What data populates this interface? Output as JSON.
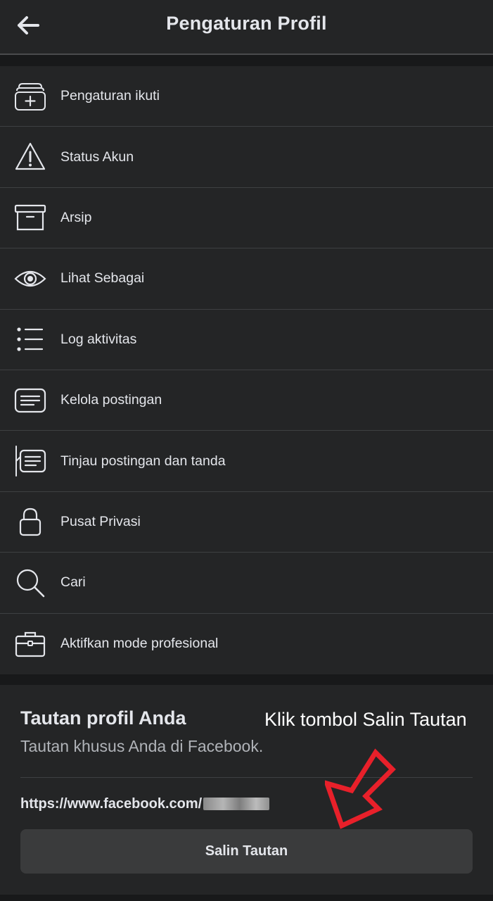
{
  "header": {
    "title": "Pengaturan Profil",
    "back_icon": "arrow-left-icon"
  },
  "menu": {
    "items": [
      {
        "label": "Pengaturan ikuti",
        "icon": "follow-settings-icon"
      },
      {
        "label": "Status Akun",
        "icon": "warning-icon"
      },
      {
        "label": "Arsip",
        "icon": "archive-icon"
      },
      {
        "label": "Lihat Sebagai",
        "icon": "eye-icon"
      },
      {
        "label": "Log aktivitas",
        "icon": "list-icon"
      },
      {
        "label": "Kelola postingan",
        "icon": "manage-posts-icon"
      },
      {
        "label": "Tinjau postingan dan tanda",
        "icon": "review-posts-icon"
      },
      {
        "label": "Pusat Privasi",
        "icon": "lock-icon"
      },
      {
        "label": "Cari",
        "icon": "search-icon"
      },
      {
        "label": "Aktifkan mode profesional",
        "icon": "briefcase-icon"
      }
    ]
  },
  "profile_link": {
    "title": "Tautan profil Anda",
    "subtitle": "Tautan khusus Anda di Facebook.",
    "url_prefix": "https://www.facebook.com/",
    "copy_button_label": "Salin Tautan"
  },
  "annotation": {
    "text": "Klik tombol Salin Tautan",
    "arrow_color": "#e8202a"
  },
  "colors": {
    "background": "#18191a",
    "surface": "#242526",
    "button": "#3a3b3c",
    "text_primary": "#e4e6eb",
    "text_secondary": "#b0b3b8"
  }
}
